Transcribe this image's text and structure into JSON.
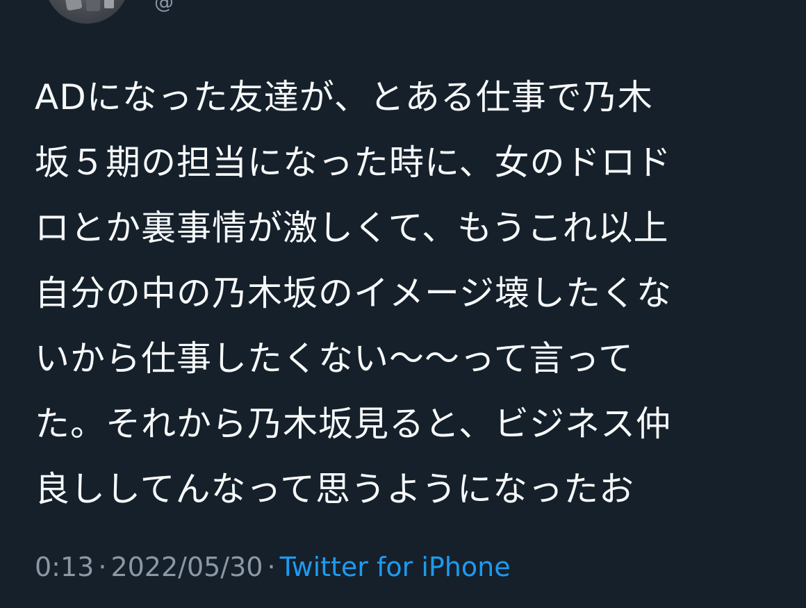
{
  "tweet": {
    "lines": [
      "ADになった友達が、とある仕事で乃木",
      "坂５期の担当になった時に、女のドロド",
      "ロとか裏事情が激しくて、もうこれ以上",
      "自分の中の乃木坂のイメージ壊したくな",
      "いから仕事したくない〜〜って言って",
      "た。それから乃木坂見ると、ビジネス仲",
      "良ししてんなって思うようになったお"
    ],
    "time": "0:13",
    "date": "2022/05/30",
    "separator": "·",
    "source": "Twitter for iPhone"
  },
  "user": {
    "handle_fragment": "@"
  },
  "colors": {
    "background": "#15202b",
    "text": "#f7f9f9",
    "secondary": "#8b98a5",
    "link": "#1d9bf0"
  }
}
